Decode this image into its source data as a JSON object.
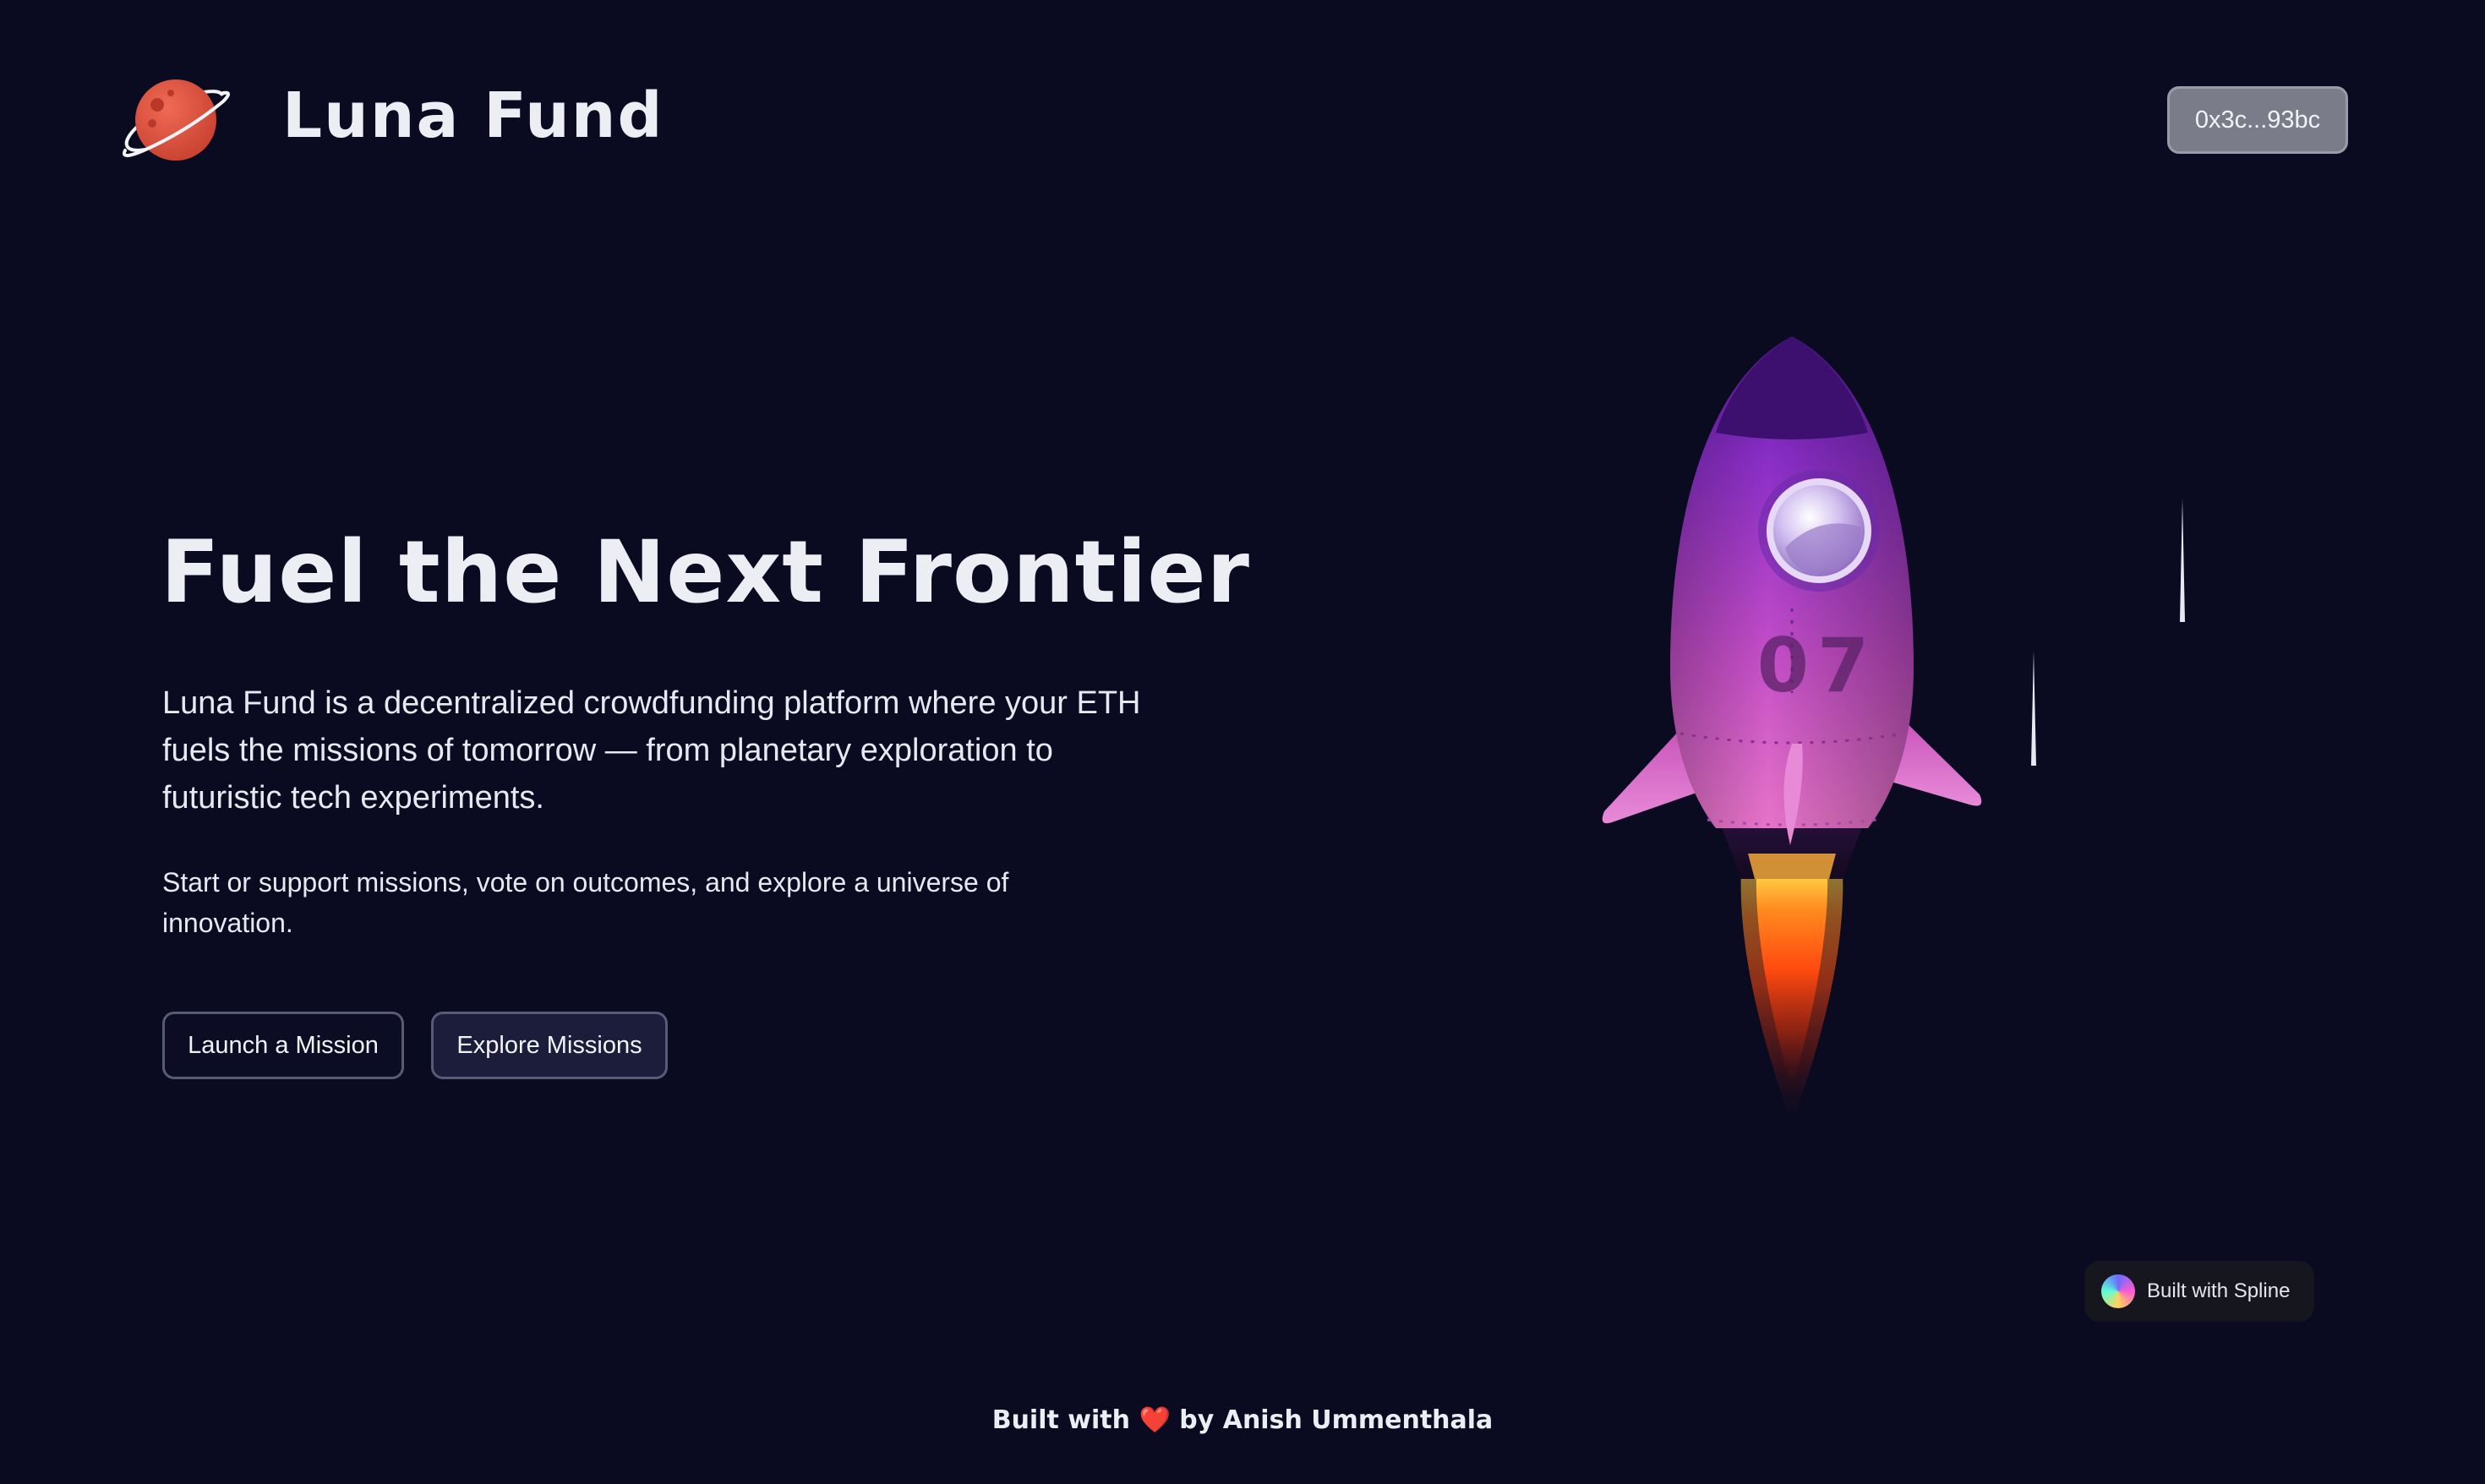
{
  "header": {
    "brand": "Luna Fund",
    "wallet_label": "0x3c...93bc"
  },
  "hero": {
    "title": "Fuel the Next Frontier",
    "description": "Luna Fund is a decentralized crowdfunding platform where your ETH fuels the missions of tomorrow — from planetary exploration to futuristic tech experiments.",
    "subtext": "Start or support missions, vote on outcomes, and explore a universe of innovation.",
    "buttons": {
      "launch": "Launch a Mission",
      "explore": "Explore Missions"
    }
  },
  "rocket": {
    "number": "07"
  },
  "spline_badge": {
    "label": "Built with Spline"
  },
  "footer": {
    "prefix": "Built with",
    "heart": "❤️",
    "suffix": "by Anish Ummenthala"
  },
  "colors": {
    "background": "#0a0b21",
    "planet": "#e85a45",
    "rocket_body": "#9b3ad0",
    "rocket_fins": "#e07ad0",
    "flame": "#ff5a14"
  },
  "icons": {
    "logo": "planet-icon",
    "badge": "spline-logo-icon"
  }
}
